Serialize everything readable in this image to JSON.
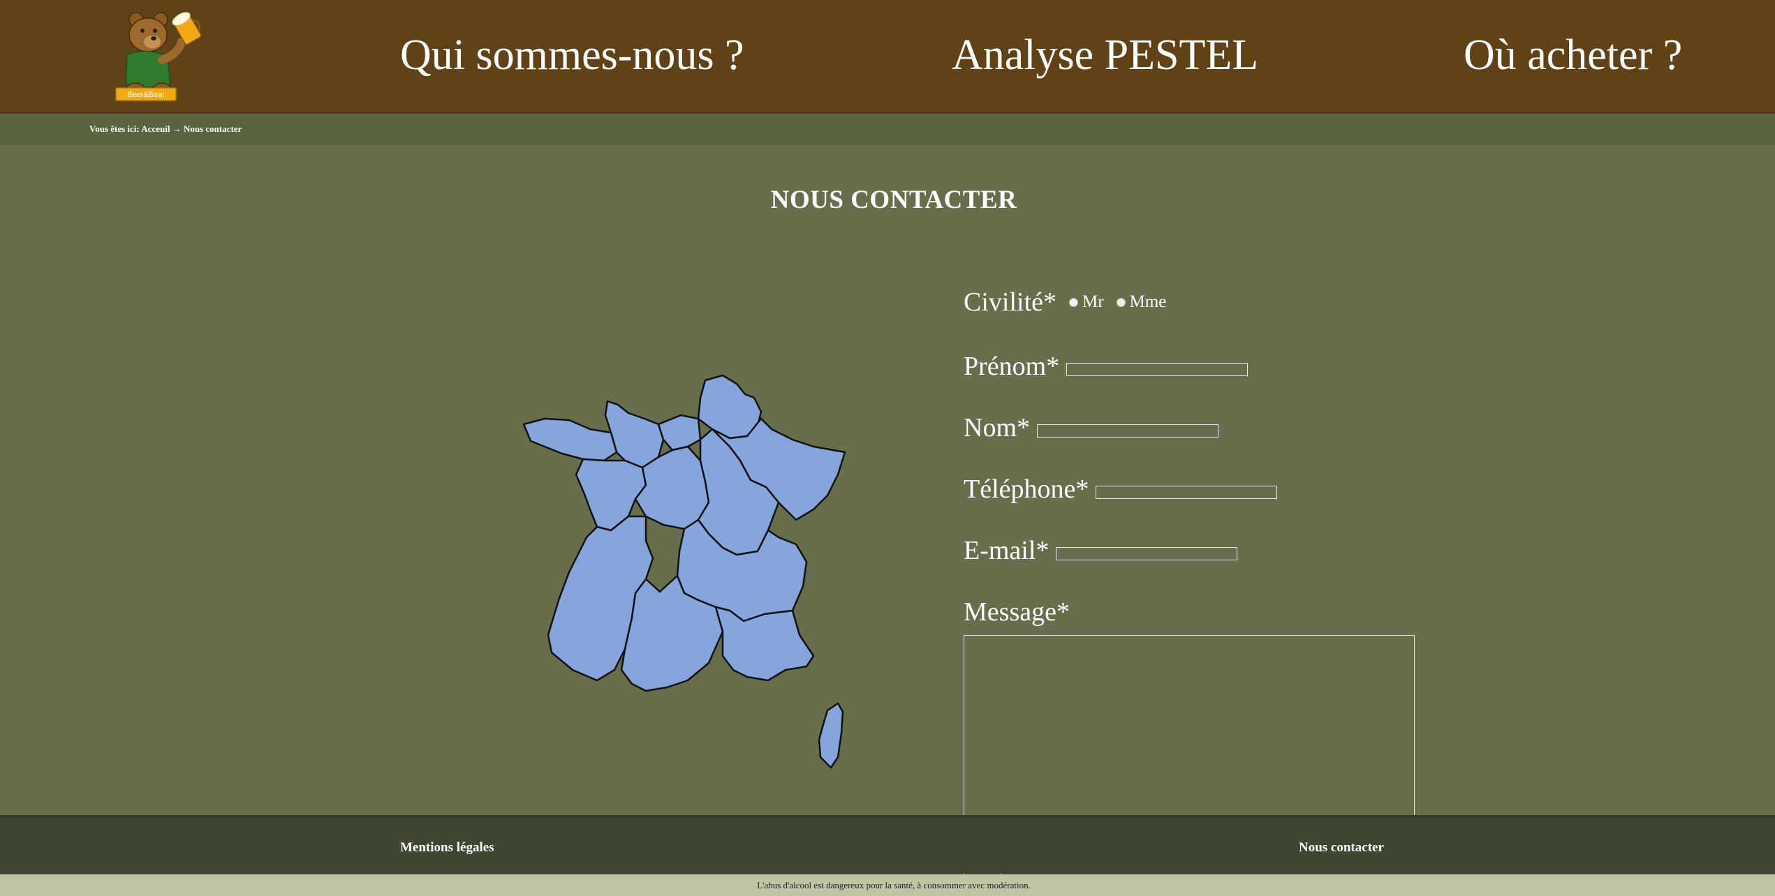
{
  "nav": {
    "logo_text": "Beer&Bear",
    "items": [
      "Qui sommes-nous ?",
      "Analyse PESTEL",
      "Où acheter ?"
    ]
  },
  "breadcrumb": {
    "prefix": "Vous êtes ici:",
    "home": "Acceuil",
    "separator": "→",
    "current": "Nous contacter"
  },
  "page": {
    "title": "NOUS CONTACTER"
  },
  "form": {
    "civilite_label": "Civilité*",
    "civilite_options": [
      "Mr",
      "Mme"
    ],
    "prenom_label": "Prénom*",
    "nom_label": "Nom*",
    "telephone_label": "Téléphone*",
    "email_label": "E-mail*",
    "message_label": "Message*"
  },
  "footer": {
    "links": [
      "Mentions légales",
      "Nous contacter"
    ],
    "disclaimer": "L'abus d'alcool est dangereux pour la santé, à consommer avec modération."
  },
  "colors": {
    "header_bg": "#614216",
    "page_bg": "#666e4b",
    "map_fill": "#86a5dd",
    "footer_bg": "#3f4631",
    "disclaimer_bg": "#c1c4a4"
  }
}
